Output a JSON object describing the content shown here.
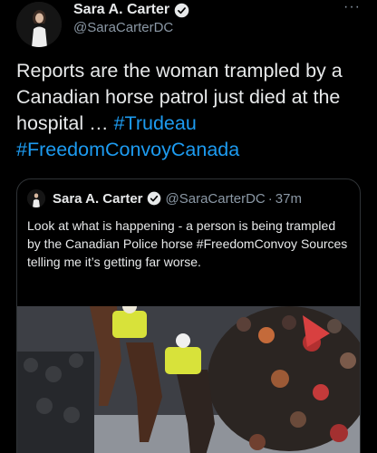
{
  "tweet": {
    "author_name": "Sara A. Carter",
    "author_handle": "@SaraCarterDC",
    "more_icon": "more-icon",
    "text_before": "Reports are the woman trampled by a Canadian horse patrol just died at the hospital … ",
    "hashtag_1": "#Trudeau",
    "hashtag_2": "#FreedomConvoyCanada"
  },
  "quoted": {
    "author_name": "Sara A. Carter",
    "author_handle": "@SaraCarterDC",
    "separator": "·",
    "time": "37m",
    "text": "Look at what is happening - a person is being trampled by the Canadian Police horse #FreedomConvoy Sources telling me it’s getting far worse.",
    "media_icon": "photo-icon"
  },
  "colors": {
    "background": "#000000",
    "text": "#e7e9ea",
    "secondary": "#8b98a5",
    "accent": "#1d9bf0"
  }
}
